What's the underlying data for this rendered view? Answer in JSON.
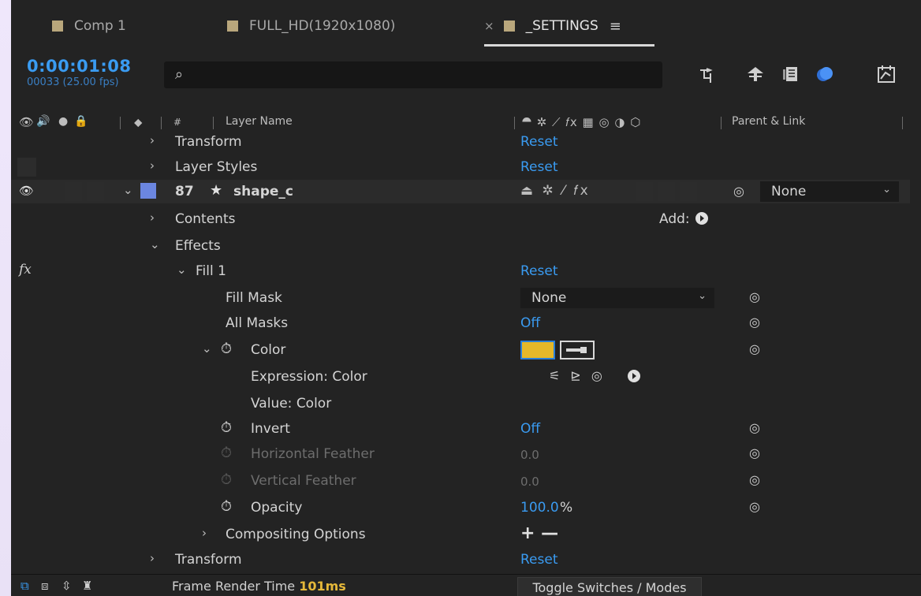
{
  "tabs": [
    {
      "label": "Comp 1",
      "swatch": "#b9a77c"
    },
    {
      "label": "FULL_HD(1920x1080)",
      "swatch": "#b9a77c"
    },
    {
      "label": "_SETTINGS",
      "swatch": "#b9a77c",
      "active": true,
      "close": "×",
      "menu": "≡"
    }
  ],
  "timecode": {
    "time": "0:00:01:08",
    "frames": "00033 (25.00 fps)"
  },
  "search": {
    "value": "",
    "placeholder": ""
  },
  "columns": {
    "hash": "#",
    "layer_name": "Layer Name",
    "parent_link": "Parent & Link"
  },
  "rows": {
    "transform_top": {
      "label": "Transform",
      "value": "Reset"
    },
    "layer_styles": {
      "label": "Layer Styles",
      "value": "Reset"
    },
    "layer": {
      "number": "87",
      "name": "shape_c",
      "color": "#6b86e0",
      "parent": "None"
    },
    "contents": {
      "label": "Contents",
      "add": "Add:"
    },
    "effects": {
      "label": "Effects"
    },
    "fill1": {
      "label": "Fill 1",
      "value": "Reset"
    },
    "fill_mask": {
      "label": "Fill Mask",
      "value": "None"
    },
    "all_masks": {
      "label": "All Masks",
      "value": "Off"
    },
    "color": {
      "label": "Color",
      "swatch": "#e5b829"
    },
    "expression_color": {
      "label": "Expression: Color"
    },
    "value_color": {
      "label": "Value: Color"
    },
    "invert": {
      "label": "Invert",
      "value": "Off"
    },
    "h_feather": {
      "label": "Horizontal Feather",
      "value": "0.0"
    },
    "v_feather": {
      "label": "Vertical Feather",
      "value": "0.0"
    },
    "opacity": {
      "label": "Opacity",
      "value": "100.0",
      "unit": "%"
    },
    "compositing": {
      "label": "Compositing Options",
      "value": "+ —"
    },
    "transform_bottom": {
      "label": "Transform",
      "value": "Reset"
    }
  },
  "footer": {
    "frame_render_label": "Frame Render Time",
    "frame_render_value": "101ms",
    "toggle": "Toggle Switches / Modes"
  },
  "colors": {
    "accent": "#3a9bf1",
    "panel": "#232323",
    "timecode": "#3a9bf1"
  }
}
